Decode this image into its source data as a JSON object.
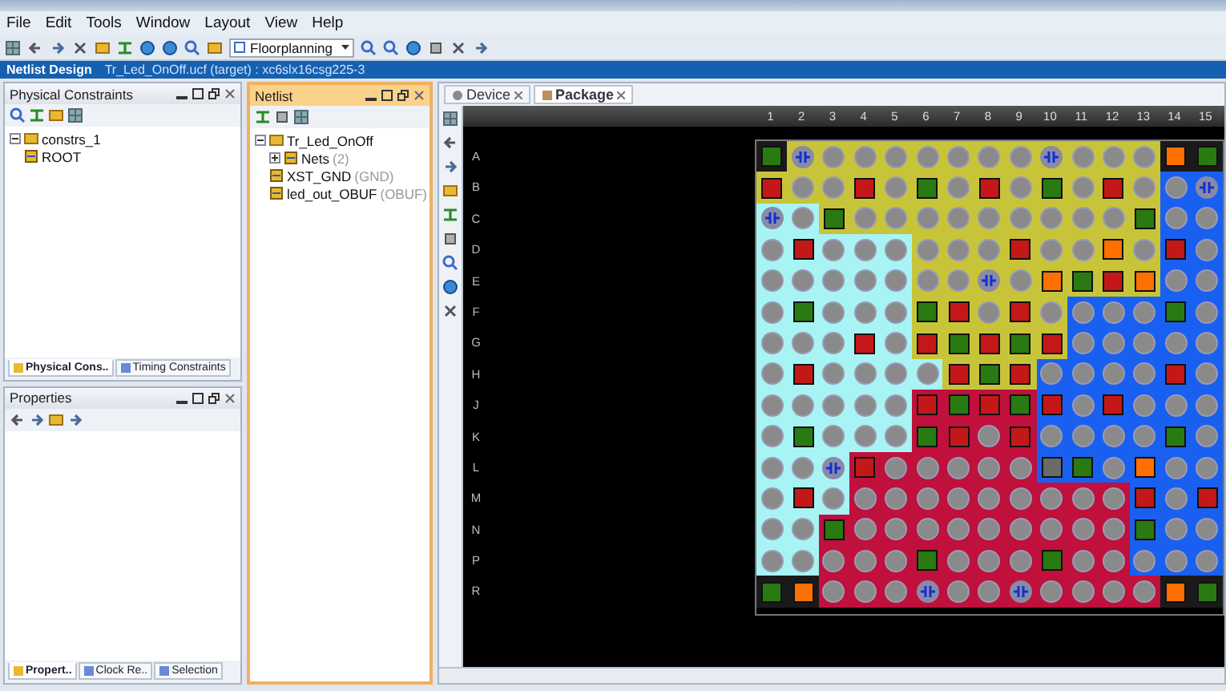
{
  "menu": [
    "File",
    "Edit",
    "Tools",
    "Window",
    "Layout",
    "View",
    "Help"
  ],
  "toolbar": {
    "layout_dropdown": "Floorplanning"
  },
  "design_bar": {
    "title": "Netlist Design",
    "subtitle": "Tr_Led_OnOff.ucf (target) : xc6slx16csg225-3"
  },
  "physical_constraints": {
    "title": "Physical Constraints",
    "tree": [
      {
        "label": "constrs_1",
        "expanded": true,
        "children": [
          {
            "label": "ROOT"
          }
        ]
      }
    ],
    "tabs": [
      {
        "label": "Physical Cons..",
        "selected": true
      },
      {
        "label": "Timing Constraints",
        "selected": false
      }
    ]
  },
  "properties": {
    "title": "Properties",
    "tabs": [
      {
        "label": "Propert..",
        "selected": true
      },
      {
        "label": "Clock Re..",
        "selected": false
      },
      {
        "label": "Selection",
        "selected": false
      }
    ]
  },
  "netlist": {
    "title": "Netlist",
    "tree": [
      {
        "label": "Tr_Led_OnOff",
        "expanded": true,
        "children": [
          {
            "label": "Nets",
            "note": "(2)",
            "expanded": false
          },
          {
            "label": "XST_GND",
            "note": "(GND)"
          },
          {
            "label": "led_out_OBUF",
            "note": "(OBUF)"
          }
        ]
      }
    ]
  },
  "package_view": {
    "tabs": [
      {
        "label": "Device",
        "selected": false
      },
      {
        "label": "Package",
        "selected": true
      }
    ],
    "columns": [
      "1",
      "2",
      "3",
      "4",
      "5",
      "6",
      "7",
      "8",
      "9",
      "10",
      "11",
      "12",
      "13",
      "14",
      "15"
    ],
    "rows": [
      {
        "label": "A",
        "cells": [
          {
            "kind": "pwr",
            "color": "#1a1a1a"
          },
          {
            "kind": "diff",
            "color": "#c8c43a"
          },
          {
            "kind": "io",
            "color": "#c8c43a"
          },
          {
            "kind": "io",
            "color": "#c8c43a"
          },
          {
            "kind": "io",
            "color": "#c8c43a"
          },
          {
            "kind": "io",
            "color": "#c8c43a"
          },
          {
            "kind": "io",
            "color": "#c8c43a"
          },
          {
            "kind": "io",
            "color": "#c8c43a"
          },
          {
            "kind": "io",
            "color": "#c8c43a"
          },
          {
            "kind": "diff",
            "color": "#c8c43a"
          },
          {
            "kind": "io",
            "color": "#c8c43a"
          },
          {
            "kind": "io",
            "color": "#c8c43a"
          },
          {
            "kind": "io",
            "color": "#c8c43a"
          },
          {
            "kind": "spec",
            "color": "#1a1a1a"
          },
          {
            "kind": "pwr",
            "color": "#1a1a1a"
          }
        ]
      },
      {
        "label": "B",
        "cells": [
          {
            "kind": "gnd",
            "color": "#c8c43a"
          },
          {
            "kind": "io",
            "color": "#c8c43a"
          },
          {
            "kind": "io",
            "color": "#c8c43a"
          },
          {
            "kind": "gnd",
            "color": "#c8c43a"
          },
          {
            "kind": "io",
            "color": "#c8c43a"
          },
          {
            "kind": "pwr",
            "color": "#c8c43a"
          },
          {
            "kind": "io",
            "color": "#c8c43a"
          },
          {
            "kind": "gnd",
            "color": "#c8c43a"
          },
          {
            "kind": "io",
            "color": "#c8c43a"
          },
          {
            "kind": "pwr",
            "color": "#c8c43a"
          },
          {
            "kind": "io",
            "color": "#c8c43a"
          },
          {
            "kind": "gnd",
            "color": "#c8c43a"
          },
          {
            "kind": "io",
            "color": "#c8c43a"
          },
          {
            "kind": "io",
            "color": "#1a60f0"
          },
          {
            "kind": "diff",
            "color": "#1a60f0"
          }
        ]
      },
      {
        "label": "C",
        "cells": [
          {
            "kind": "diff",
            "color": "#a8f4f4"
          },
          {
            "kind": "io",
            "color": "#a8f4f4"
          },
          {
            "kind": "pwr",
            "color": "#c8c43a"
          },
          {
            "kind": "io",
            "color": "#c8c43a"
          },
          {
            "kind": "io",
            "color": "#c8c43a"
          },
          {
            "kind": "io",
            "color": "#c8c43a"
          },
          {
            "kind": "io",
            "color": "#c8c43a"
          },
          {
            "kind": "io",
            "color": "#c8c43a"
          },
          {
            "kind": "io",
            "color": "#c8c43a"
          },
          {
            "kind": "io",
            "color": "#c8c43a"
          },
          {
            "kind": "io",
            "color": "#c8c43a"
          },
          {
            "kind": "io",
            "color": "#c8c43a"
          },
          {
            "kind": "pwr",
            "color": "#c8c43a"
          },
          {
            "kind": "io",
            "color": "#1a60f0"
          },
          {
            "kind": "io",
            "color": "#1a60f0"
          }
        ]
      },
      {
        "label": "D",
        "cells": [
          {
            "kind": "io",
            "color": "#a8f4f4"
          },
          {
            "kind": "gnd",
            "color": "#a8f4f4"
          },
          {
            "kind": "io",
            "color": "#a8f4f4"
          },
          {
            "kind": "io",
            "color": "#a8f4f4"
          },
          {
            "kind": "io",
            "color": "#a8f4f4"
          },
          {
            "kind": "io",
            "color": "#c8c43a"
          },
          {
            "kind": "io",
            "color": "#c8c43a"
          },
          {
            "kind": "io",
            "color": "#c8c43a"
          },
          {
            "kind": "gnd",
            "color": "#c8c43a"
          },
          {
            "kind": "io",
            "color": "#c8c43a"
          },
          {
            "kind": "io",
            "color": "#c8c43a"
          },
          {
            "kind": "spec",
            "color": "#c8c43a"
          },
          {
            "kind": "io",
            "color": "#c8c43a"
          },
          {
            "kind": "gnd",
            "color": "#1a60f0"
          },
          {
            "kind": "io",
            "color": "#1a60f0"
          }
        ]
      },
      {
        "label": "E",
        "cells": [
          {
            "kind": "io",
            "color": "#a8f4f4"
          },
          {
            "kind": "io",
            "color": "#a8f4f4"
          },
          {
            "kind": "io",
            "color": "#a8f4f4"
          },
          {
            "kind": "io",
            "color": "#a8f4f4"
          },
          {
            "kind": "io",
            "color": "#a8f4f4"
          },
          {
            "kind": "io",
            "color": "#c8c43a"
          },
          {
            "kind": "io",
            "color": "#c8c43a"
          },
          {
            "kind": "diff",
            "color": "#c8c43a"
          },
          {
            "kind": "io",
            "color": "#c8c43a"
          },
          {
            "kind": "spec",
            "color": "#c8c43a"
          },
          {
            "kind": "pwr",
            "color": "#c8c43a"
          },
          {
            "kind": "gnd",
            "color": "#c8c43a"
          },
          {
            "kind": "spec",
            "color": "#c8c43a"
          },
          {
            "kind": "io",
            "color": "#1a60f0"
          },
          {
            "kind": "io",
            "color": "#1a60f0"
          }
        ]
      },
      {
        "label": "F",
        "cells": [
          {
            "kind": "io",
            "color": "#a8f4f4"
          },
          {
            "kind": "pwr",
            "color": "#a8f4f4"
          },
          {
            "kind": "io",
            "color": "#a8f4f4"
          },
          {
            "kind": "io",
            "color": "#a8f4f4"
          },
          {
            "kind": "io",
            "color": "#a8f4f4"
          },
          {
            "kind": "pwr",
            "color": "#c8c43a"
          },
          {
            "kind": "gnd",
            "color": "#c8c43a"
          },
          {
            "kind": "io",
            "color": "#c8c43a"
          },
          {
            "kind": "gnd",
            "color": "#c8c43a"
          },
          {
            "kind": "io",
            "color": "#c8c43a"
          },
          {
            "kind": "io",
            "color": "#1a60f0"
          },
          {
            "kind": "io",
            "color": "#1a60f0"
          },
          {
            "kind": "io",
            "color": "#1a60f0"
          },
          {
            "kind": "pwr",
            "color": "#1a60f0"
          },
          {
            "kind": "io",
            "color": "#1a60f0"
          }
        ]
      },
      {
        "label": "G",
        "cells": [
          {
            "kind": "io",
            "color": "#a8f4f4"
          },
          {
            "kind": "io",
            "color": "#a8f4f4"
          },
          {
            "kind": "io",
            "color": "#a8f4f4"
          },
          {
            "kind": "gnd",
            "color": "#a8f4f4"
          },
          {
            "kind": "io",
            "color": "#a8f4f4"
          },
          {
            "kind": "gnd",
            "color": "#c8c43a"
          },
          {
            "kind": "pwr",
            "color": "#c8c43a"
          },
          {
            "kind": "gnd",
            "color": "#c8c43a"
          },
          {
            "kind": "pwr",
            "color": "#c8c43a"
          },
          {
            "kind": "gnd",
            "color": "#c8c43a"
          },
          {
            "kind": "io",
            "color": "#1a60f0"
          },
          {
            "kind": "io",
            "color": "#1a60f0"
          },
          {
            "kind": "io",
            "color": "#1a60f0"
          },
          {
            "kind": "io",
            "color": "#1a60f0"
          },
          {
            "kind": "io",
            "color": "#1a60f0"
          }
        ]
      },
      {
        "label": "H",
        "cells": [
          {
            "kind": "io",
            "color": "#a8f4f4"
          },
          {
            "kind": "gnd",
            "color": "#a8f4f4"
          },
          {
            "kind": "io",
            "color": "#a8f4f4"
          },
          {
            "kind": "io",
            "color": "#a8f4f4"
          },
          {
            "kind": "io",
            "color": "#a8f4f4"
          },
          {
            "kind": "io",
            "color": "#a8f4f4"
          },
          {
            "kind": "gnd",
            "color": "#c8c43a"
          },
          {
            "kind": "pwr",
            "color": "#c8c43a"
          },
          {
            "kind": "gnd",
            "color": "#c8c43a"
          },
          {
            "kind": "io",
            "color": "#1a60f0"
          },
          {
            "kind": "io",
            "color": "#1a60f0"
          },
          {
            "kind": "io",
            "color": "#1a60f0"
          },
          {
            "kind": "io",
            "color": "#1a60f0"
          },
          {
            "kind": "gnd",
            "color": "#1a60f0"
          },
          {
            "kind": "io",
            "color": "#1a60f0"
          }
        ]
      },
      {
        "label": "J",
        "cells": [
          {
            "kind": "io",
            "color": "#a8f4f4"
          },
          {
            "kind": "io",
            "color": "#a8f4f4"
          },
          {
            "kind": "io",
            "color": "#a8f4f4"
          },
          {
            "kind": "io",
            "color": "#a8f4f4"
          },
          {
            "kind": "io",
            "color": "#a8f4f4"
          },
          {
            "kind": "gnd",
            "color": "#c0103c"
          },
          {
            "kind": "pwr",
            "color": "#c0103c"
          },
          {
            "kind": "gnd",
            "color": "#c0103c"
          },
          {
            "kind": "pwr",
            "color": "#c0103c"
          },
          {
            "kind": "gnd",
            "color": "#1a60f0"
          },
          {
            "kind": "io",
            "color": "#1a60f0"
          },
          {
            "kind": "gnd",
            "color": "#1a60f0"
          },
          {
            "kind": "io",
            "color": "#1a60f0"
          },
          {
            "kind": "io",
            "color": "#1a60f0"
          },
          {
            "kind": "io",
            "color": "#1a60f0"
          }
        ]
      },
      {
        "label": "K",
        "cells": [
          {
            "kind": "io",
            "color": "#a8f4f4"
          },
          {
            "kind": "pwr",
            "color": "#a8f4f4"
          },
          {
            "kind": "io",
            "color": "#a8f4f4"
          },
          {
            "kind": "io",
            "color": "#a8f4f4"
          },
          {
            "kind": "io",
            "color": "#a8f4f4"
          },
          {
            "kind": "pwr",
            "color": "#c0103c"
          },
          {
            "kind": "gnd",
            "color": "#c0103c"
          },
          {
            "kind": "io",
            "color": "#c0103c"
          },
          {
            "kind": "gnd",
            "color": "#c0103c"
          },
          {
            "kind": "io",
            "color": "#1a60f0"
          },
          {
            "kind": "io",
            "color": "#1a60f0"
          },
          {
            "kind": "io",
            "color": "#1a60f0"
          },
          {
            "kind": "io",
            "color": "#1a60f0"
          },
          {
            "kind": "pwr",
            "color": "#1a60f0"
          },
          {
            "kind": "io",
            "color": "#1a60f0"
          }
        ]
      },
      {
        "label": "L",
        "cells": [
          {
            "kind": "io",
            "color": "#a8f4f4"
          },
          {
            "kind": "io",
            "color": "#a8f4f4"
          },
          {
            "kind": "diff",
            "color": "#a8f4f4"
          },
          {
            "kind": "gnd",
            "color": "#c0103c"
          },
          {
            "kind": "io",
            "color": "#c0103c"
          },
          {
            "kind": "io",
            "color": "#c0103c"
          },
          {
            "kind": "io",
            "color": "#c0103c"
          },
          {
            "kind": "io",
            "color": "#c0103c"
          },
          {
            "kind": "io",
            "color": "#c0103c"
          },
          {
            "kind": "nc",
            "color": "#1a60f0"
          },
          {
            "kind": "pwr",
            "color": "#1a60f0"
          },
          {
            "kind": "io",
            "color": "#1a60f0"
          },
          {
            "kind": "spec",
            "color": "#1a60f0"
          },
          {
            "kind": "io",
            "color": "#1a60f0"
          },
          {
            "kind": "io",
            "color": "#1a60f0"
          }
        ]
      },
      {
        "label": "M",
        "cells": [
          {
            "kind": "io",
            "color": "#a8f4f4"
          },
          {
            "kind": "gnd",
            "color": "#a8f4f4"
          },
          {
            "kind": "io",
            "color": "#a8f4f4"
          },
          {
            "kind": "io",
            "color": "#c0103c"
          },
          {
            "kind": "io",
            "color": "#c0103c"
          },
          {
            "kind": "io",
            "color": "#c0103c"
          },
          {
            "kind": "io",
            "color": "#c0103c"
          },
          {
            "kind": "io",
            "color": "#c0103c"
          },
          {
            "kind": "io",
            "color": "#c0103c"
          },
          {
            "kind": "io",
            "color": "#c0103c"
          },
          {
            "kind": "io",
            "color": "#c0103c"
          },
          {
            "kind": "io",
            "color": "#c0103c"
          },
          {
            "kind": "gnd",
            "color": "#1a60f0"
          },
          {
            "kind": "io",
            "color": "#1a60f0"
          },
          {
            "kind": "gnd",
            "color": "#1a60f0"
          }
        ]
      },
      {
        "label": "N",
        "cells": [
          {
            "kind": "io",
            "color": "#a8f4f4"
          },
          {
            "kind": "io",
            "color": "#a8f4f4"
          },
          {
            "kind": "pwr",
            "color": "#c0103c"
          },
          {
            "kind": "io",
            "color": "#c0103c"
          },
          {
            "kind": "io",
            "color": "#c0103c"
          },
          {
            "kind": "io",
            "color": "#c0103c"
          },
          {
            "kind": "io",
            "color": "#c0103c"
          },
          {
            "kind": "io",
            "color": "#c0103c"
          },
          {
            "kind": "io",
            "color": "#c0103c"
          },
          {
            "kind": "io",
            "color": "#c0103c"
          },
          {
            "kind": "io",
            "color": "#c0103c"
          },
          {
            "kind": "io",
            "color": "#c0103c"
          },
          {
            "kind": "pwr",
            "color": "#1a60f0"
          },
          {
            "kind": "io",
            "color": "#1a60f0"
          },
          {
            "kind": "io",
            "color": "#1a60f0"
          }
        ]
      },
      {
        "label": "P",
        "cells": [
          {
            "kind": "io",
            "color": "#a8f4f4"
          },
          {
            "kind": "io",
            "color": "#a8f4f4"
          },
          {
            "kind": "io",
            "color": "#c0103c"
          },
          {
            "kind": "io",
            "color": "#c0103c"
          },
          {
            "kind": "io",
            "color": "#c0103c"
          },
          {
            "kind": "pwr",
            "color": "#c0103c"
          },
          {
            "kind": "io",
            "color": "#c0103c"
          },
          {
            "kind": "io",
            "color": "#c0103c"
          },
          {
            "kind": "io",
            "color": "#c0103c"
          },
          {
            "kind": "pwr",
            "color": "#c0103c"
          },
          {
            "kind": "io",
            "color": "#c0103c"
          },
          {
            "kind": "io",
            "color": "#c0103c"
          },
          {
            "kind": "io",
            "color": "#1a60f0"
          },
          {
            "kind": "io",
            "color": "#1a60f0"
          },
          {
            "kind": "io",
            "color": "#1a60f0"
          }
        ]
      },
      {
        "label": "R",
        "cells": [
          {
            "kind": "pwr",
            "color": "#1a1a1a"
          },
          {
            "kind": "spec",
            "color": "#1a1a1a"
          },
          {
            "kind": "io",
            "color": "#c0103c"
          },
          {
            "kind": "io",
            "color": "#c0103c"
          },
          {
            "kind": "io",
            "color": "#c0103c"
          },
          {
            "kind": "diff",
            "color": "#c0103c"
          },
          {
            "kind": "io",
            "color": "#c0103c"
          },
          {
            "kind": "io",
            "color": "#c0103c"
          },
          {
            "kind": "diff",
            "color": "#c0103c"
          },
          {
            "kind": "io",
            "color": "#c0103c"
          },
          {
            "kind": "io",
            "color": "#c0103c"
          },
          {
            "kind": "io",
            "color": "#c0103c"
          },
          {
            "kind": "io",
            "color": "#c0103c"
          },
          {
            "kind": "spec",
            "color": "#1a1a1a"
          },
          {
            "kind": "pwr",
            "color": "#1a1a1a"
          }
        ]
      }
    ]
  }
}
